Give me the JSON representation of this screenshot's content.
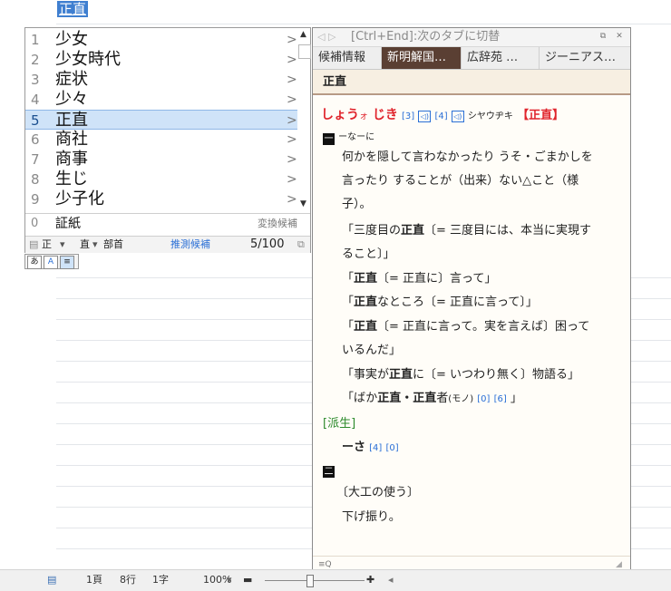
{
  "composition": {
    "text": "正直"
  },
  "candidates": {
    "items": [
      {
        "num": "1",
        "word": "少女",
        "arrow": ">"
      },
      {
        "num": "2",
        "word": "少女時代",
        "arrow": ">"
      },
      {
        "num": "3",
        "word": "症状",
        "arrow": ">"
      },
      {
        "num": "4",
        "word": "少々",
        "arrow": ">"
      },
      {
        "num": "5",
        "word": "正直",
        "arrow": ">",
        "selected": true
      },
      {
        "num": "6",
        "word": "商社",
        "arrow": ">"
      },
      {
        "num": "7",
        "word": "商事",
        "arrow": ">"
      },
      {
        "num": "8",
        "word": "生じ",
        "arrow": ">"
      },
      {
        "num": "9",
        "word": "少子化",
        "arrow": ">"
      }
    ],
    "extra": {
      "num": "0",
      "word": "証紙",
      "label": "変換候補"
    },
    "footer": {
      "kanji_1": "正",
      "kanji_2": "直",
      "bushu": "部首",
      "predict": "推測候補",
      "page": "5/100"
    },
    "mode_buttons": [
      "あ",
      "A",
      "≡"
    ]
  },
  "dict": {
    "title": "[Ctrl+End]:次のタブに切替",
    "tabs": [
      "候補情報",
      "新明解国…",
      "広辞苑 …",
      "ジーニアス…"
    ],
    "active_tab": 1,
    "headword": "正直",
    "entry": {
      "reading_1": "しょう",
      "reading_small_o": "ォ",
      "reading_2": " じき",
      "ref_3": "[3]",
      "ref_4": "[4]",
      "katakana": "シヤウヂキ",
      "kanji_bracket": "【正直】",
      "sense_1_mark": "一",
      "sense_1_tag": "ーなーに",
      "def_line_1": "何かを隠して言わなかったり うそ・ごまかしを",
      "def_line_2": "言ったり することが（出来）ない△こと（様",
      "def_line_3": "子）。",
      "ex_1_open": "「三度目の",
      "ex_1_bold": "正直",
      "ex_1_rest": "〔= 三度目には、本当に実現す",
      "ex_1_line2": "ること〕」",
      "ex_2_open": "「",
      "ex_2_bold": "正直",
      "ex_2_rest": "〔= 正直に〕言って」",
      "ex_3_open": "「",
      "ex_3_bold": "正直",
      "ex_3_rest": "なところ〔= 正直に言って〕」",
      "ex_4_open": "「",
      "ex_4_bold": "正直",
      "ex_4_rest": "〔= 正直に言って。実を言えば〕困って",
      "ex_4_line2": "いるんだ」",
      "ex_5_open": "「事実が",
      "ex_5_bold": "正直",
      "ex_5_rest": "に〔= いつわり無く〕物語る」",
      "ex_6_open": "「ばか",
      "ex_6_bold": "正直・正直",
      "ex_6_rest": "者",
      "ex_6_small": "(モノ)",
      "ex_6_ref0": "[0]",
      "ex_6_ref6": "[6]",
      "ex_6_close": " 」",
      "derived_label": "[派生]",
      "derived_word": "ーさ",
      "derived_ref4": "[4]",
      "derived_ref0": "[0]",
      "sense_2_mark": "二",
      "sense_2_tag": "〔大工の使う〕",
      "sense_2_def": "下げ振り。"
    },
    "footer_icon": "≡Q"
  },
  "statusbar": {
    "page": "1頁",
    "line": "8行",
    "char": "1字",
    "zoom": "100%"
  },
  "colors": {
    "selection": "#cfe3f8",
    "active_tab": "#5a3f33",
    "accent_red": "#e0242c",
    "ref_blue": "#2a6fd6"
  }
}
